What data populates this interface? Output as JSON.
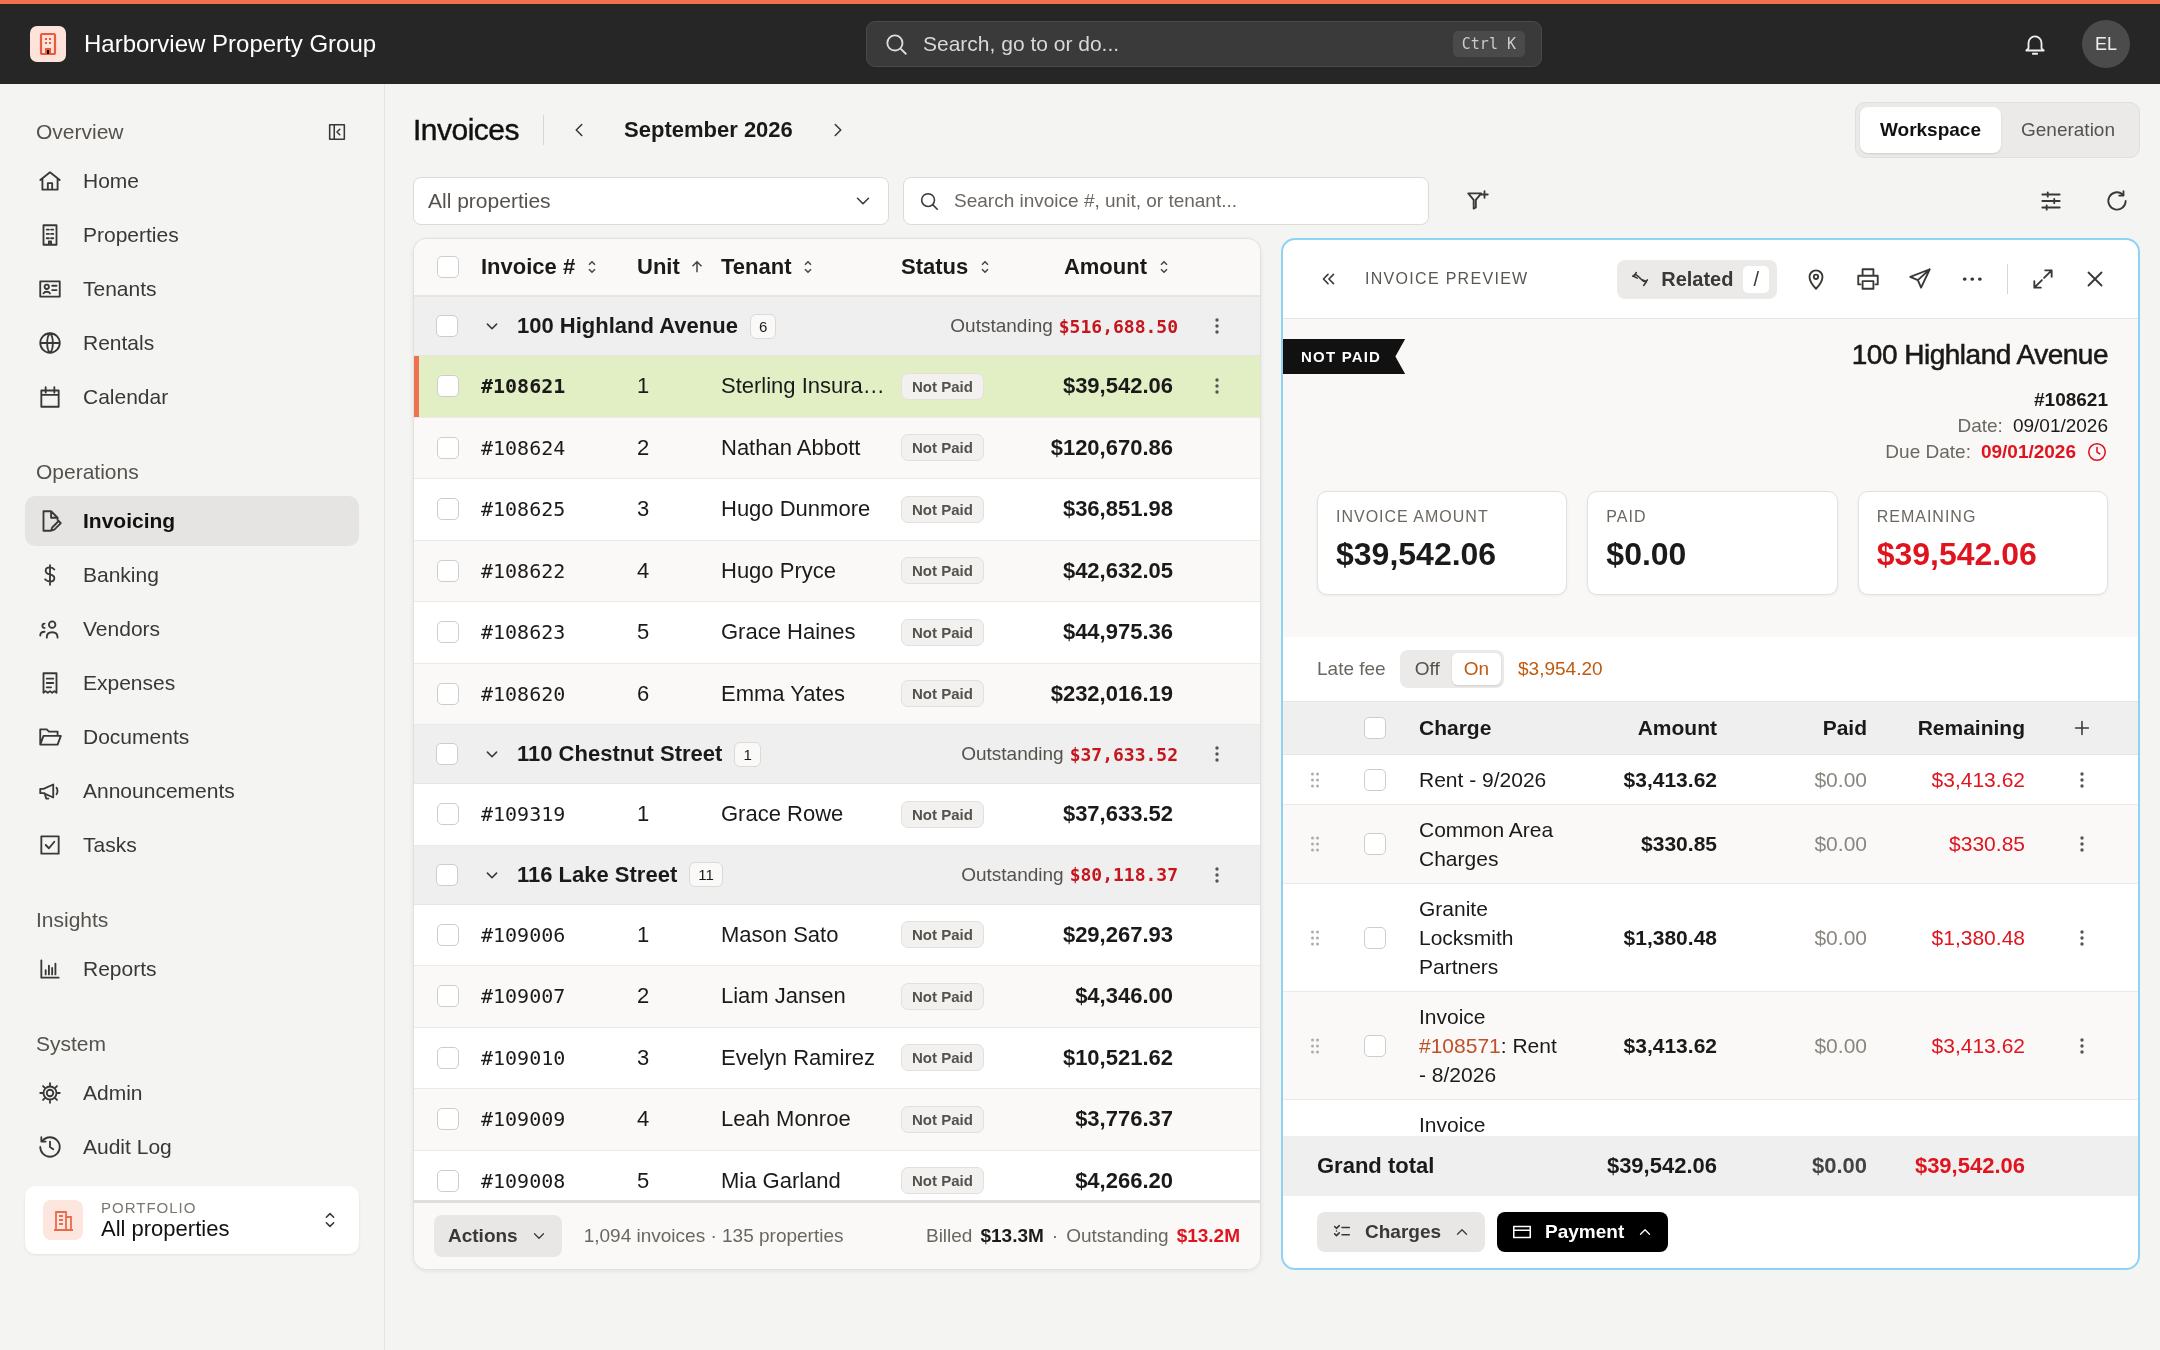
{
  "app": {
    "name": "Harborview Property Group",
    "user_initials": "EL"
  },
  "search": {
    "placeholder": "Search, go to or do...",
    "shortcut": "Ctrl K"
  },
  "sidebar": {
    "sections": [
      {
        "title": "Overview",
        "items": [
          {
            "label": "Home",
            "selected": false
          },
          {
            "label": "Properties",
            "selected": false
          },
          {
            "label": "Tenants",
            "selected": false
          },
          {
            "label": "Rentals",
            "selected": false
          },
          {
            "label": "Calendar",
            "selected": false
          }
        ]
      },
      {
        "title": "Operations",
        "items": [
          {
            "label": "Invoicing",
            "selected": true
          },
          {
            "label": "Banking",
            "selected": false
          },
          {
            "label": "Vendors",
            "selected": false
          },
          {
            "label": "Expenses",
            "selected": false
          },
          {
            "label": "Documents",
            "selected": false
          },
          {
            "label": "Announcements",
            "selected": false
          },
          {
            "label": "Tasks",
            "selected": false
          }
        ]
      },
      {
        "title": "Insights",
        "items": [
          {
            "label": "Reports",
            "selected": false
          }
        ]
      },
      {
        "title": "System",
        "items": [
          {
            "label": "Admin",
            "selected": false
          },
          {
            "label": "Audit Log",
            "selected": false
          }
        ]
      }
    ],
    "portfolio": {
      "label": "PORTFOLIO",
      "value": "All properties"
    }
  },
  "page": {
    "title": "Invoices",
    "period": "September 2026",
    "views": [
      {
        "label": "Workspace",
        "selected": true
      },
      {
        "label": "Generation",
        "selected": false
      }
    ]
  },
  "filters": {
    "property": "All properties",
    "search_placeholder": "Search invoice #, unit, or tenant..."
  },
  "table": {
    "select_all_checked": false,
    "columns": [
      {
        "label": "Invoice #",
        "sorted": false
      },
      {
        "label": "Unit",
        "sorted": true
      },
      {
        "label": "Tenant",
        "sorted": false
      },
      {
        "label": "Status",
        "sorted": false
      },
      {
        "label": "Amount",
        "sorted": false
      }
    ],
    "groups": [
      {
        "name": "100 Highland Avenue",
        "count": "6",
        "outstanding_label": "Outstanding",
        "outstanding": "$516,688.50",
        "expanded": true,
        "checked": false,
        "rows": [
          {
            "invoice": "#108621",
            "unit": "1",
            "tenant": "Sterling Insura…",
            "status": "Not Paid",
            "amount": "$39,542.06",
            "selected": true,
            "checked": false
          },
          {
            "invoice": "#108624",
            "unit": "2",
            "tenant": "Nathan Abbott",
            "status": "Not Paid",
            "amount": "$120,670.86",
            "selected": false,
            "checked": false
          },
          {
            "invoice": "#108625",
            "unit": "3",
            "tenant": "Hugo Dunmore",
            "status": "Not Paid",
            "amount": "$36,851.98",
            "selected": false,
            "checked": false
          },
          {
            "invoice": "#108622",
            "unit": "4",
            "tenant": "Hugo Pryce",
            "status": "Not Paid",
            "amount": "$42,632.05",
            "selected": false,
            "checked": false
          },
          {
            "invoice": "#108623",
            "unit": "5",
            "tenant": "Grace Haines",
            "status": "Not Paid",
            "amount": "$44,975.36",
            "selected": false,
            "checked": false
          },
          {
            "invoice": "#108620",
            "unit": "6",
            "tenant": "Emma Yates",
            "status": "Not Paid",
            "amount": "$232,016.19",
            "selected": false,
            "checked": false
          }
        ]
      },
      {
        "name": "110 Chestnut Street",
        "count": "1",
        "outstanding_label": "Outstanding",
        "outstanding": "$37,633.52",
        "expanded": true,
        "checked": false,
        "rows": [
          {
            "invoice": "#109319",
            "unit": "1",
            "tenant": "Grace Rowe",
            "status": "Not Paid",
            "amount": "$37,633.52",
            "selected": false,
            "checked": false
          }
        ]
      },
      {
        "name": "116 Lake Street",
        "count": "11",
        "outstanding_label": "Outstanding",
        "outstanding": "$80,118.37",
        "expanded": true,
        "checked": false,
        "rows": [
          {
            "invoice": "#109006",
            "unit": "1",
            "tenant": "Mason Sato",
            "status": "Not Paid",
            "amount": "$29,267.93",
            "selected": false,
            "checked": false
          },
          {
            "invoice": "#109007",
            "unit": "2",
            "tenant": "Liam Jansen",
            "status": "Not Paid",
            "amount": "$4,346.00",
            "selected": false,
            "checked": false
          },
          {
            "invoice": "#109010",
            "unit": "3",
            "tenant": "Evelyn Ramirez",
            "status": "Not Paid",
            "amount": "$10,521.62",
            "selected": false,
            "checked": false
          },
          {
            "invoice": "#109009",
            "unit": "4",
            "tenant": "Leah Monroe",
            "status": "Not Paid",
            "amount": "$3,776.37",
            "selected": false,
            "checked": false
          },
          {
            "invoice": "#109008",
            "unit": "5",
            "tenant": "Mia Garland",
            "status": "Not Paid",
            "amount": "$4,266.20",
            "selected": false,
            "checked": false
          }
        ]
      }
    ],
    "footer": {
      "actions": "Actions",
      "summary": "1,094 invoices · 135 properties",
      "billed_label": "Billed",
      "billed": "$13.3M",
      "separator": "·",
      "outstanding_label": "Outstanding",
      "outstanding": "$13.2M"
    }
  },
  "preview": {
    "title": "INVOICE PREVIEW",
    "related": "Related",
    "related_shortcut": "/",
    "status": "NOT PAID",
    "property": "100 Highland Avenue",
    "invoice": "#108621",
    "date_label": "Date:",
    "date": "09/01/2026",
    "due_label": "Due Date:",
    "due": "09/01/2026",
    "overdue": true,
    "cards": [
      {
        "label": "INVOICE AMOUNT",
        "value": "$39,542.06",
        "kind": "normal"
      },
      {
        "label": "PAID",
        "value": "$0.00",
        "kind": "normal"
      },
      {
        "label": "REMAINING",
        "value": "$39,542.06",
        "kind": "due"
      }
    ],
    "late_fee": {
      "label": "Late fee",
      "options": [
        {
          "label": "Off",
          "selected": false
        },
        {
          "label": "On",
          "selected": true
        }
      ],
      "amount": "$3,954.20"
    },
    "charges": {
      "select_all_checked": false,
      "columns": [
        "Charge",
        "Amount",
        "Paid",
        "Remaining"
      ],
      "rows": [
        {
          "charge": "Rent - 9/2026",
          "amount": "$3,413.62",
          "paid": "$0.00",
          "remaining": "$3,413.62",
          "checked": false
        },
        {
          "charge": "Common Area Charges",
          "amount": "$330.85",
          "paid": "$0.00",
          "remaining": "$330.85",
          "checked": false
        },
        {
          "charge": "Granite Locksmith Partners",
          "amount": "$1,380.48",
          "paid": "$0.00",
          "remaining": "$1,380.48",
          "checked": false
        },
        {
          "charge": "Invoice",
          "link": "#108571",
          "suffix": ": Rent - 8/2026",
          "amount": "$3,413.62",
          "paid": "$0.00",
          "remaining": "$3,413.62",
          "checked": false
        },
        {
          "charge": "Invoice"
        }
      ],
      "total": {
        "label": "Grand total",
        "amount": "$39,542.06",
        "paid": "$0.00",
        "remaining": "$39,542.06"
      }
    },
    "buttons": [
      {
        "label": "Charges",
        "kind": "secondary"
      },
      {
        "label": "Payment",
        "kind": "primary"
      }
    ]
  }
}
